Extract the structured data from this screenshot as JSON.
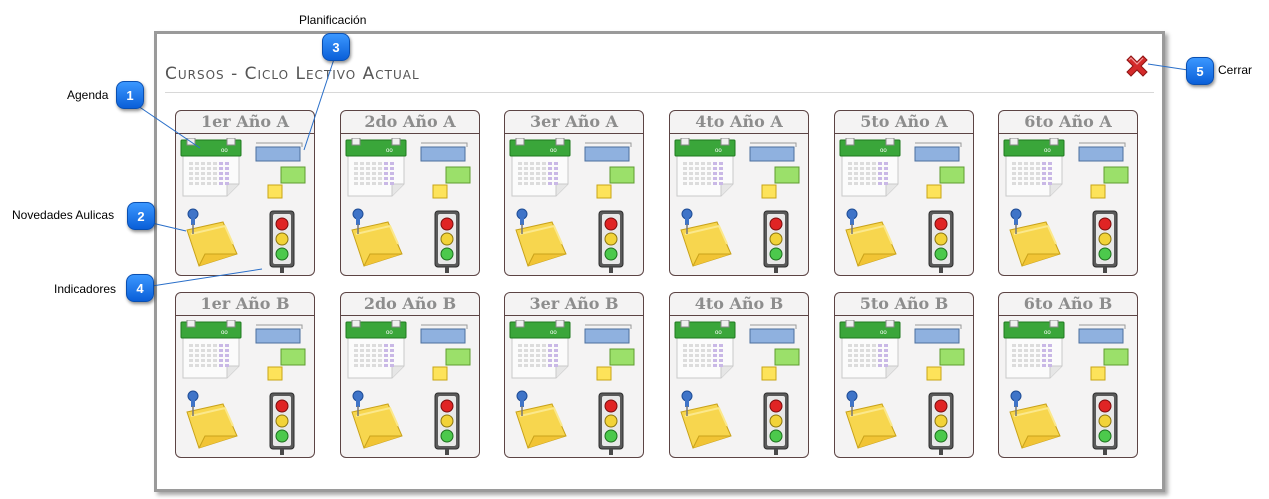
{
  "window": {
    "title": "Cursos - Ciclo Lectivo Actual"
  },
  "callouts": [
    {
      "number": "1",
      "label": "Agenda"
    },
    {
      "number": "2",
      "label": "Novedades Aulicas"
    },
    {
      "number": "3",
      "label": "Planificación"
    },
    {
      "number": "4",
      "label": "Indicadores"
    },
    {
      "number": "5",
      "label": "Cerrar"
    }
  ],
  "courses_row_a": [
    {
      "name": "1er Año A"
    },
    {
      "name": "2do Año A"
    },
    {
      "name": "3er Año A"
    },
    {
      "name": "4to Año A"
    },
    {
      "name": "5to Año A"
    },
    {
      "name": "6to Año A"
    }
  ],
  "courses_row_b": [
    {
      "name": "1er Año B"
    },
    {
      "name": "2do Año B"
    },
    {
      "name": "3er Año B"
    },
    {
      "name": "4to Año B"
    },
    {
      "name": "5to Año B"
    },
    {
      "name": "6to Año B"
    }
  ],
  "icons": {
    "agenda": "calendar-icon",
    "planning": "planning-icon",
    "notes": "sticky-note-icon",
    "indicators": "traffic-light-icon",
    "close": "close-icon"
  },
  "colors": {
    "badge": "#1a7cf0",
    "close": "#d42a2a",
    "card_border": "#5c4444"
  }
}
